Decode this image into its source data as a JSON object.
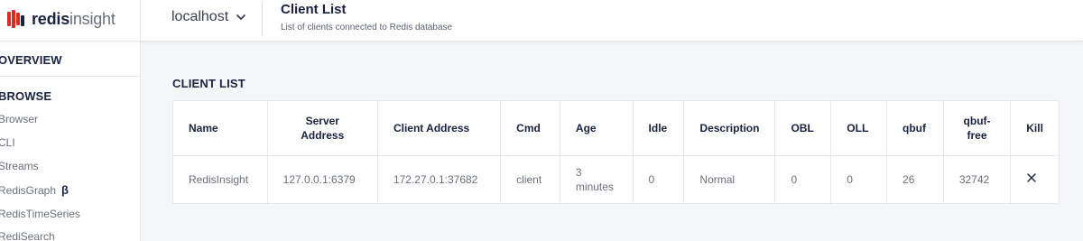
{
  "app": {
    "logo_bold": "redis",
    "logo_light": "insight"
  },
  "header": {
    "database": "localhost",
    "title": "Client List",
    "subtitle": "List of clients connected to Redis database"
  },
  "sidebar": {
    "overview": "OVERVIEW",
    "browse": "BROWSE",
    "items": [
      {
        "label": "Browser"
      },
      {
        "label": "CLI"
      },
      {
        "label": "Streams"
      },
      {
        "label": "RedisGraph",
        "badge": "β"
      },
      {
        "label": "RedisTimeSeries"
      },
      {
        "label": "RediSearch"
      }
    ]
  },
  "main": {
    "section_title": "CLIENT LIST",
    "columns": [
      "Name",
      "Server Address",
      "Client Address",
      "Cmd",
      "Age",
      "Idle",
      "Description",
      "OBL",
      "OLL",
      "qbuf",
      "qbuf-free",
      "Kill"
    ],
    "rows": [
      {
        "name": "RedisInsight",
        "server_address": "127.0.0.1:6379",
        "client_address": "172.27.0.1:37682",
        "cmd": "client",
        "age": "3 minutes",
        "idle": "0",
        "description": "Normal",
        "obl": "0",
        "oll": "0",
        "qbuf": "26",
        "qbuf_free": "32742",
        "kill_icon": "close-icon"
      }
    ]
  },
  "colors": {
    "brand_red": "#d82c20",
    "text_dark": "#1b2240",
    "text_muted": "#6a6f7e",
    "background": "#f5f6f8",
    "border": "#e6e8ee"
  }
}
